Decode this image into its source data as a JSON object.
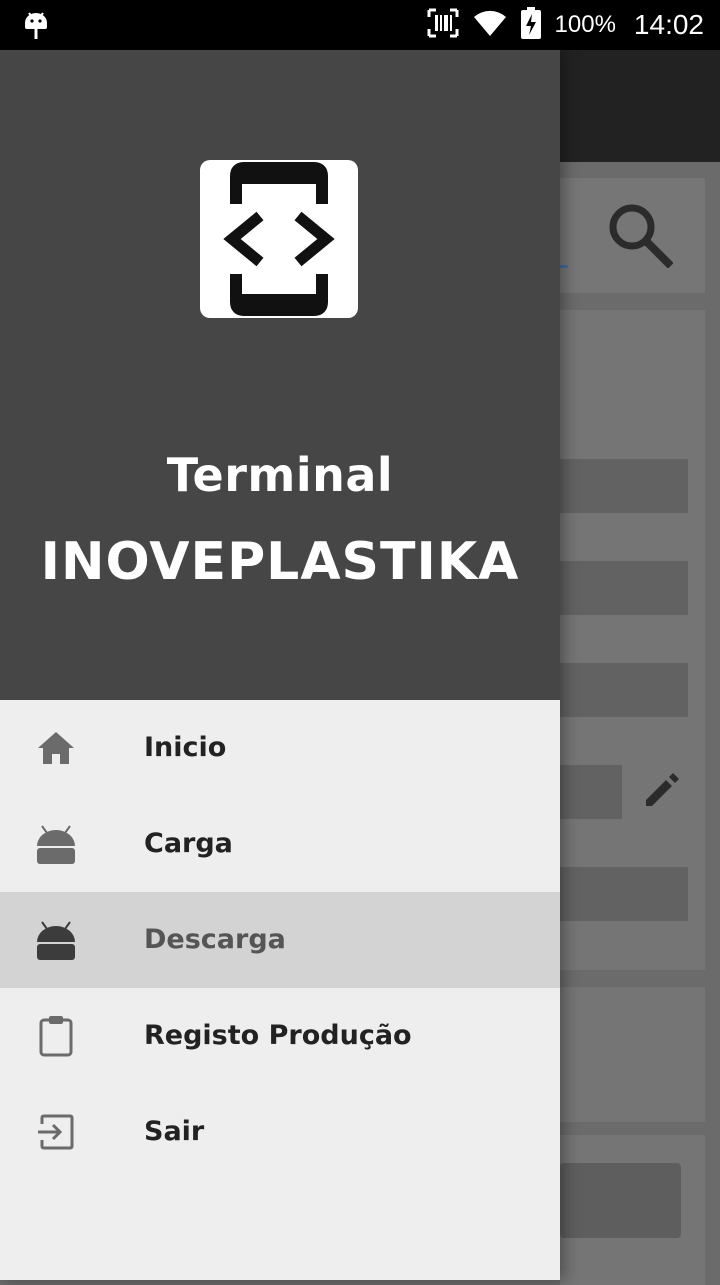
{
  "status_bar": {
    "battery_text": "100%",
    "time": "14:02"
  },
  "drawer": {
    "header": {
      "title": "Terminal",
      "subtitle": "INOVEPLASTIKA",
      "logo_icon": "code-brackets-phone-icon"
    },
    "menu": [
      {
        "label": "Inicio",
        "icon": "home-icon",
        "selected": false
      },
      {
        "label": "Carga",
        "icon": "android-icon",
        "selected": false
      },
      {
        "label": "Descarga",
        "icon": "android-icon",
        "selected": true
      },
      {
        "label": "Registo Produção",
        "icon": "clipboard-icon",
        "selected": false
      },
      {
        "label": "Sair",
        "icon": "exit-icon",
        "selected": false
      }
    ]
  },
  "colors": {
    "drawer_header": "#464646",
    "drawer_body": "#eeeeee",
    "selected_item": "#d3d3d3",
    "status_bar": "#000000"
  }
}
